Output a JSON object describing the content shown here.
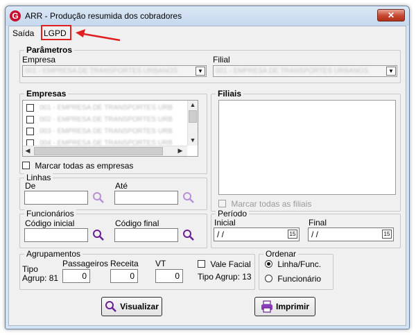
{
  "window": {
    "title": "ARR - Produção resumida dos cobradores",
    "close_glyph": "✕"
  },
  "menu": {
    "items": [
      {
        "label": "Saída"
      },
      {
        "label": "LGPD"
      }
    ]
  },
  "parametros": {
    "title": "Parâmetros",
    "empresa_label": "Empresa",
    "empresa_value": "001 - EMPRESA DE TRANSPORTES URBANOS",
    "filial_label": "Filial",
    "filial_value": "001 - EMPRESA DE TRANSPORTES URBANOS"
  },
  "empresas": {
    "title": "Empresas",
    "items": [
      "001 - EMPRESA DE TRANSPORTES URB",
      "002 - EMPRESA DE TRANSPORTES URB",
      "003 - EMPRESA DE TRANSPORTES URB",
      "004 - EMPRESA DE TRANSPORTES URB"
    ],
    "select_all_label": "Marcar todas as empresas"
  },
  "filiais": {
    "title": "Filiais",
    "select_all_label": "Marcar todas as filiais"
  },
  "linhas": {
    "title": "Linhas",
    "de_label": "De",
    "ate_label": "Até",
    "de_value": "",
    "ate_value": ""
  },
  "funcionarios": {
    "title": "Funcionários",
    "codigo_inicial_label": "Código inicial",
    "codigo_final_label": "Código final",
    "codigo_inicial_value": "",
    "codigo_final_value": ""
  },
  "periodo": {
    "title": "Período",
    "inicial_label": "Inicial",
    "final_label": "Final",
    "inicial_value": "/ /",
    "final_value": "/ /",
    "calendar_glyph": "15"
  },
  "agrupamentos": {
    "title": "Agrupamentos",
    "tipo_label_1": "Tipo",
    "tipo_label_2": "Agrup: 81",
    "passageiros_label": "Passageiros",
    "passageiros_value": "0",
    "receita_label": "Receita",
    "receita_value": "0",
    "vt_label": "VT",
    "vt_value": "0",
    "vale_facial_label": "Vale Facial",
    "tipo_agrup_13": "Tipo Agrup: 13"
  },
  "ordenar": {
    "title": "Ordenar",
    "options": [
      {
        "label": "Linha/Func.",
        "selected": true
      },
      {
        "label": "Funcionário",
        "selected": false
      }
    ]
  },
  "actions": {
    "visualizar_label": "Visualizar",
    "imprimir_label": "Imprimir"
  },
  "colors": {
    "highlight_box": "#e02020",
    "lookup_icon": "#7a2ea8",
    "brand": "#c8102e"
  }
}
